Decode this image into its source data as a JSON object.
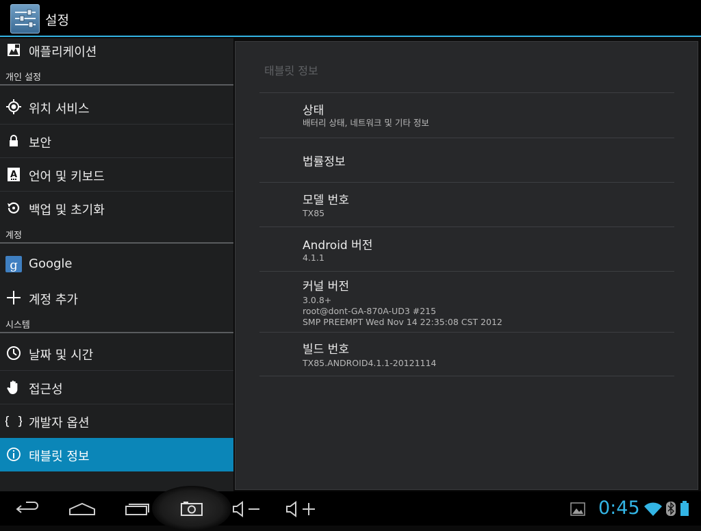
{
  "action_bar": {
    "title": "설정",
    "icon": "settings-icon"
  },
  "sidebar": {
    "top_item": {
      "label": "애플리케이션",
      "icon": "apps-icon"
    },
    "section_personal": "개인 설정",
    "location": {
      "label": "위치 서비스",
      "icon": "location-icon"
    },
    "security": {
      "label": "보안",
      "icon": "lock-icon"
    },
    "language": {
      "label": "언어 및 키보드",
      "icon": "language-icon"
    },
    "backup": {
      "label": "백업 및 초기화",
      "icon": "backup-icon"
    },
    "section_accounts": "계정",
    "google": {
      "label": "Google",
      "icon": "google-icon"
    },
    "add_account": {
      "label": "계정 추가",
      "icon": "plus-icon"
    },
    "section_system": "시스템",
    "datetime": {
      "label": "날짜 및 시간",
      "icon": "clock-icon"
    },
    "accessibility": {
      "label": "접근성",
      "icon": "hand-icon"
    },
    "developer": {
      "label": "개발자 옵션",
      "icon": "braces-icon"
    },
    "about": {
      "label": "태블릿 정보",
      "icon": "info-icon",
      "selected": true
    }
  },
  "panel": {
    "title": "태블릿 정보",
    "status": {
      "title": "상태",
      "summary": "배터리 상태, 네트워크 및 기타 정보"
    },
    "legal": {
      "title": "법률정보"
    },
    "model": {
      "title": "모델 번호",
      "value": "TX85"
    },
    "android": {
      "title": "Android 버전",
      "value": "4.1.1"
    },
    "kernel": {
      "title": "커널 버전",
      "line1": "3.0.8+",
      "line2": "root@dont-GA-870A-UD3 #215",
      "line3": "SMP PREEMPT Wed Nov 14 22:35:08 CST 2012"
    },
    "build": {
      "title": "빌드 번호",
      "value": "TX85.ANDROID4.1.1-20121114"
    }
  },
  "navbar": {
    "buttons": [
      "back-icon",
      "home-icon",
      "recent-apps-icon",
      "screenshot-icon",
      "volume-down-icon",
      "volume-up-icon"
    ],
    "clock": "0:45",
    "status_icons": [
      "gallery-icon",
      "wifi-icon",
      "bluetooth-icon",
      "battery-icon"
    ]
  },
  "colors": {
    "accent": "#33b5e5",
    "selected_bg": "#0b86b8",
    "panel_bg": "#27282a",
    "sidebar_bg": "#1e1f20"
  }
}
